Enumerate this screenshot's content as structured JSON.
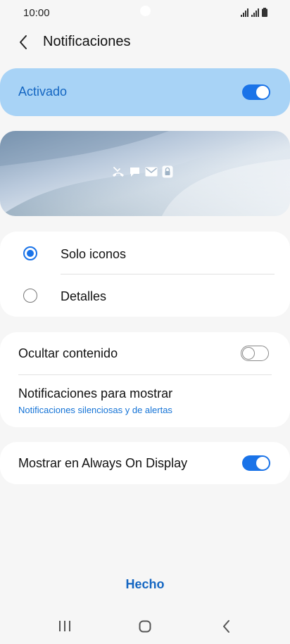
{
  "status": {
    "time": "10:00",
    "icons": [
      "signal-icon",
      "signal-icon",
      "battery-icon"
    ]
  },
  "header": {
    "title": "Notificaciones",
    "back_icon": "back-arrow-icon"
  },
  "master": {
    "label": "Activado",
    "enabled": true
  },
  "preview": {
    "icons": [
      "missed-call-icon",
      "message-icon",
      "email-icon",
      "lock-icon"
    ]
  },
  "style_options": {
    "items": [
      {
        "label": "Solo iconos",
        "selected": true
      },
      {
        "label": "Detalles",
        "selected": false
      }
    ]
  },
  "privacy": {
    "hide_content_label": "Ocultar contenido",
    "hide_content_enabled": false,
    "show_label": "Notificaciones para mostrar",
    "show_value": "Notificaciones silenciosas y de alertas"
  },
  "aod": {
    "label": "Mostrar en Always On Display",
    "enabled": true
  },
  "footer": {
    "done_label": "Hecho"
  },
  "navigation": {
    "buttons": [
      "recent-apps-icon",
      "home-icon",
      "back-icon"
    ]
  },
  "colors": {
    "accent": "#1a73e8",
    "master_bg": "#a8d3f6",
    "master_text": "#1466c2",
    "background": "#f6f6f6"
  }
}
